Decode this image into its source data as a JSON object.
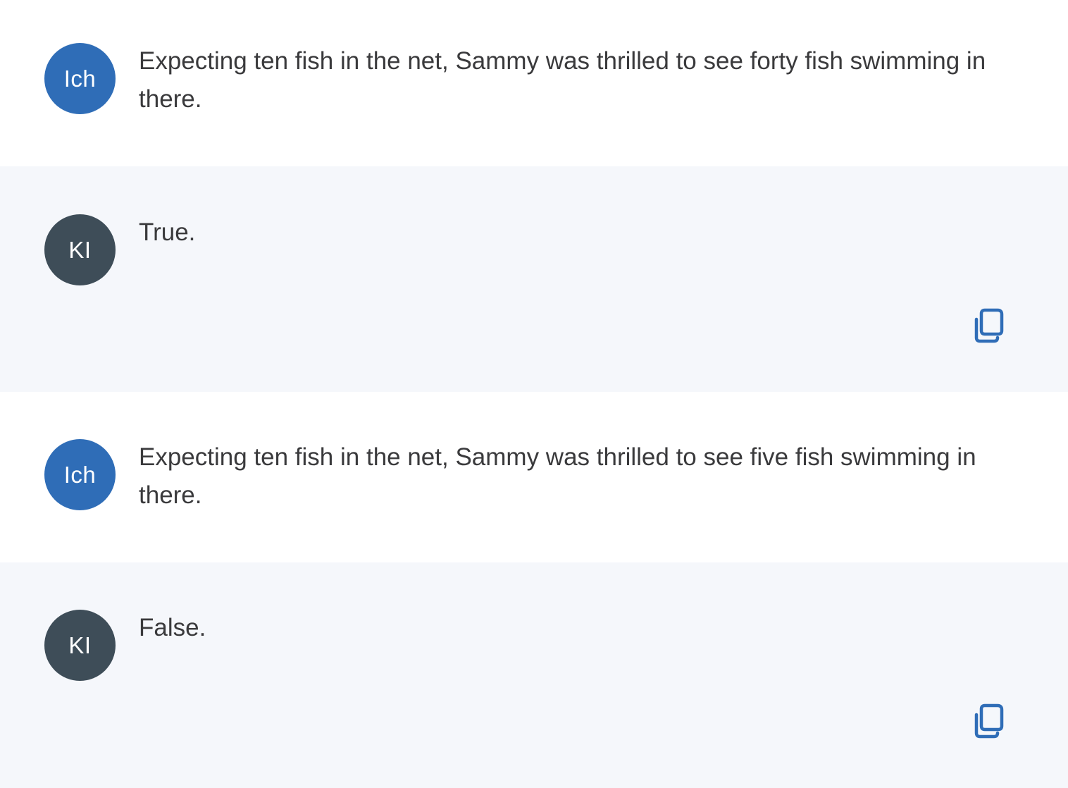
{
  "messages": [
    {
      "role": "user",
      "avatar_label": "Ich",
      "text": "Expecting ten fish in the net, Sammy was thrilled to see forty fish swimming in there."
    },
    {
      "role": "ai",
      "avatar_label": "KI",
      "text": "True.",
      "copy_icon": "copy-icon"
    },
    {
      "role": "user",
      "avatar_label": "Ich",
      "text": "Expecting ten fish in the net, Sammy was thrilled to see five fish swimming in there."
    },
    {
      "role": "ai",
      "avatar_label": "KI",
      "text": "False.",
      "copy_icon": "copy-icon"
    }
  ],
  "colors": {
    "user_avatar": "#2f6db7",
    "ai_avatar": "#3e4d58",
    "ai_background": "#f5f7fb",
    "user_background": "#ffffff",
    "text": "#3a3a3c",
    "icon_accent": "#2f6db7"
  }
}
